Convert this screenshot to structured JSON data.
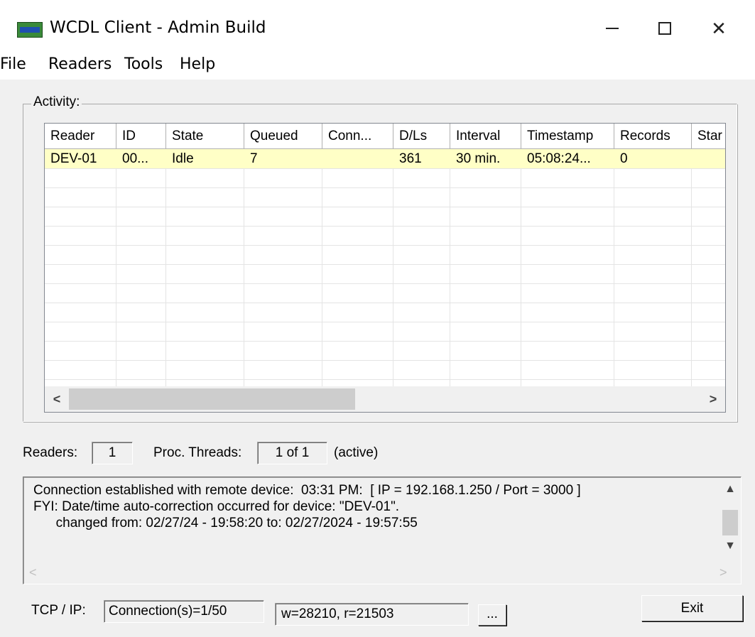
{
  "window": {
    "title": "WCDL Client - Admin Build",
    "icon": "wcdl-app-icon",
    "controls": {
      "minimize": "minimize-icon",
      "maximize": "maximize-icon",
      "close": "close-icon"
    }
  },
  "menu": [
    "File",
    "Readers",
    "Tools",
    "Help"
  ],
  "activity": {
    "label": "Activity:",
    "columns": [
      "Reader",
      "ID",
      "State",
      "Queued",
      "Conn...",
      "D/Ls",
      "Interval",
      "Timestamp",
      "Records",
      "Star"
    ],
    "rows": [
      [
        "DEV-01",
        "00...",
        "Idle",
        "7",
        "",
        "361",
        "30 min.",
        "05:08:24...",
        "0",
        ""
      ]
    ],
    "selected_row_color": "#ffffc6",
    "scroll_left": "<",
    "scroll_right": ">"
  },
  "status": {
    "readers_label": "Readers:",
    "readers_value": "1",
    "threads_label": "Proc. Threads:",
    "threads_value": "1 of 1",
    "threads_note": "(active)"
  },
  "log": {
    "lines": [
      "Connection established with remote device:  03:31 PM:  [ IP = 192.168.1.250 / Port = 3000 ]",
      "FYI: Date/time auto-correction occurred for device: \"DEV-01\".",
      "      changed from: 02/27/24 - 19:58:20 to: 02/27/2024 - 19:57:55"
    ]
  },
  "footer": {
    "tcp_label": "TCP / IP:",
    "connections": "Connection(s)=1/50",
    "rw": "w=28210, r=21503",
    "more_button": "...",
    "exit_button": "Exit"
  }
}
